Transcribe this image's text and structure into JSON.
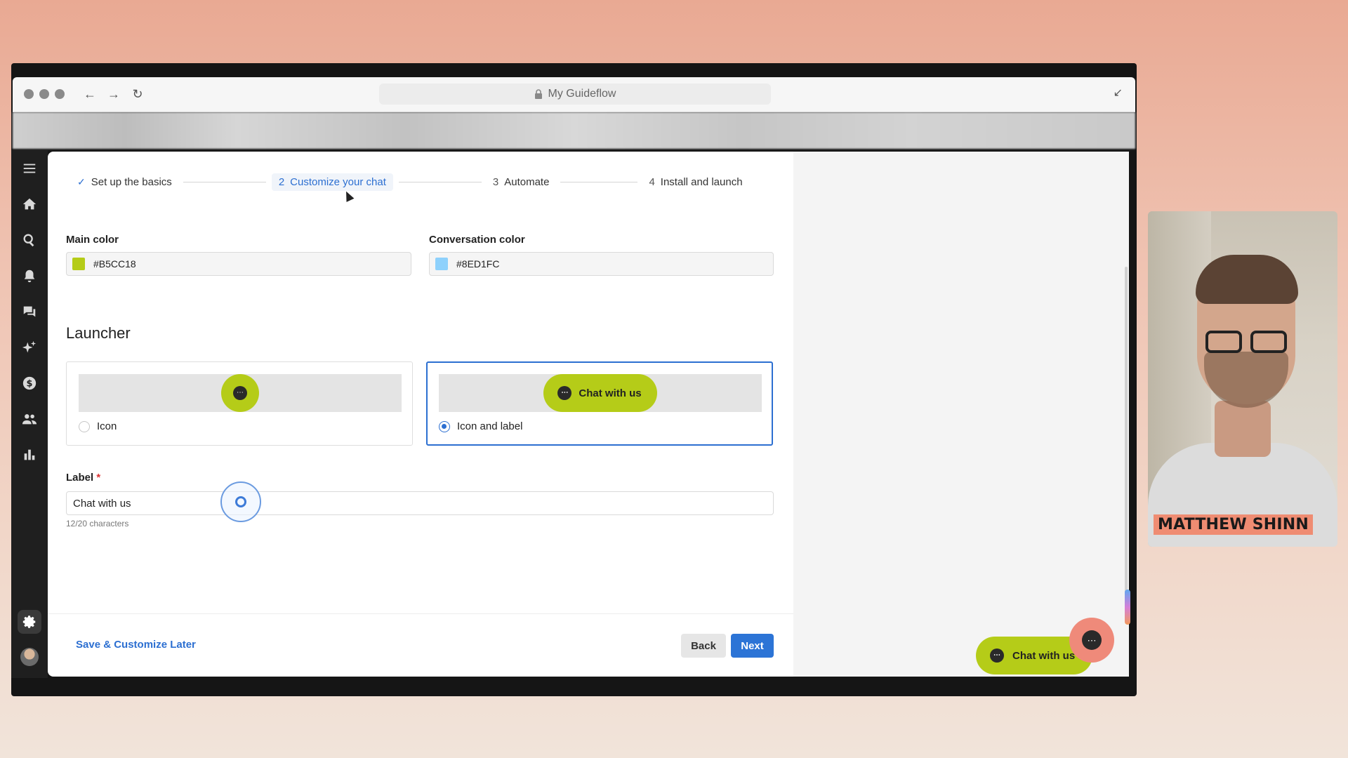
{
  "browser": {
    "url_title": "My Guideflow"
  },
  "stepper": {
    "steps": [
      {
        "number": "",
        "label": "Set up the basics",
        "state": "done"
      },
      {
        "number": "2",
        "label": "Customize your chat",
        "state": "active"
      },
      {
        "number": "3",
        "label": "Automate",
        "state": "pending"
      },
      {
        "number": "4",
        "label": "Install and launch",
        "state": "pending"
      }
    ]
  },
  "colors": {
    "main_label": "Main color",
    "main_value": "#B5CC18",
    "conversation_label": "Conversation color",
    "conversation_value": "#8ED1FC",
    "accent": "#2c6fd1"
  },
  "launcher": {
    "title": "Launcher",
    "options": [
      {
        "label": "Icon",
        "selected": false
      },
      {
        "label": "Icon and label",
        "selected": true,
        "preview_text": "Chat with us"
      }
    ]
  },
  "label_field": {
    "label": "Label",
    "required_mark": "*",
    "value": "Chat with us",
    "char_count": "12/20 characters"
  },
  "footer": {
    "save_later": "Save & Customize Later",
    "back": "Back",
    "next": "Next"
  },
  "widget": {
    "pill_text": "Chat with us",
    "bubble_icon": "chat-dots-icon"
  },
  "webcam": {
    "name": "MATTHEW SHINN"
  }
}
